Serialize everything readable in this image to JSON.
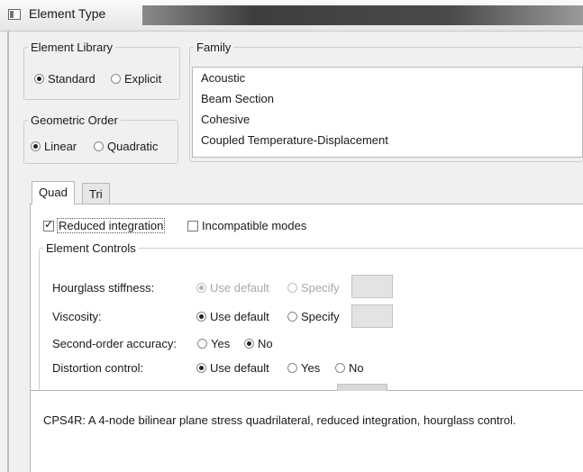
{
  "window": {
    "title": "Element Type"
  },
  "element_library": {
    "legend": "Element Library",
    "options": [
      {
        "label": "Standard",
        "selected": true
      },
      {
        "label": "Explicit",
        "selected": false
      }
    ]
  },
  "geometric_order": {
    "legend": "Geometric Order",
    "options": [
      {
        "label": "Linear",
        "selected": true
      },
      {
        "label": "Quadratic",
        "selected": false
      }
    ]
  },
  "family": {
    "legend": "Family",
    "items": [
      "Acoustic",
      "Beam Section",
      "Cohesive",
      "Coupled Temperature-Displacement"
    ]
  },
  "tabs": [
    {
      "label": "Quad",
      "active": true
    },
    {
      "label": "Tri",
      "active": false
    }
  ],
  "integration": {
    "reduced_label": "Reduced integration",
    "reduced_checked": true,
    "incompatible_label": "Incompatible modes",
    "incompatible_checked": false
  },
  "element_controls": {
    "legend": "Element Controls",
    "hourglass": {
      "label": "Hourglass stiffness:",
      "opt1": "Use default",
      "opt2": "Specify",
      "enabled": false
    },
    "viscosity": {
      "label": "Viscosity:",
      "opt1": "Use default",
      "opt2": "Specify"
    },
    "second_order": {
      "label": "Second-order accuracy:",
      "opt1": "Yes",
      "opt2": "No"
    },
    "distortion": {
      "label": "Distortion control:",
      "opt1": "Use default",
      "opt2": "Yes",
      "opt3": "No"
    }
  },
  "description": "CPS4R:  A 4-node bilinear plane stress quadrilateral, reduced integration, hourglass control."
}
